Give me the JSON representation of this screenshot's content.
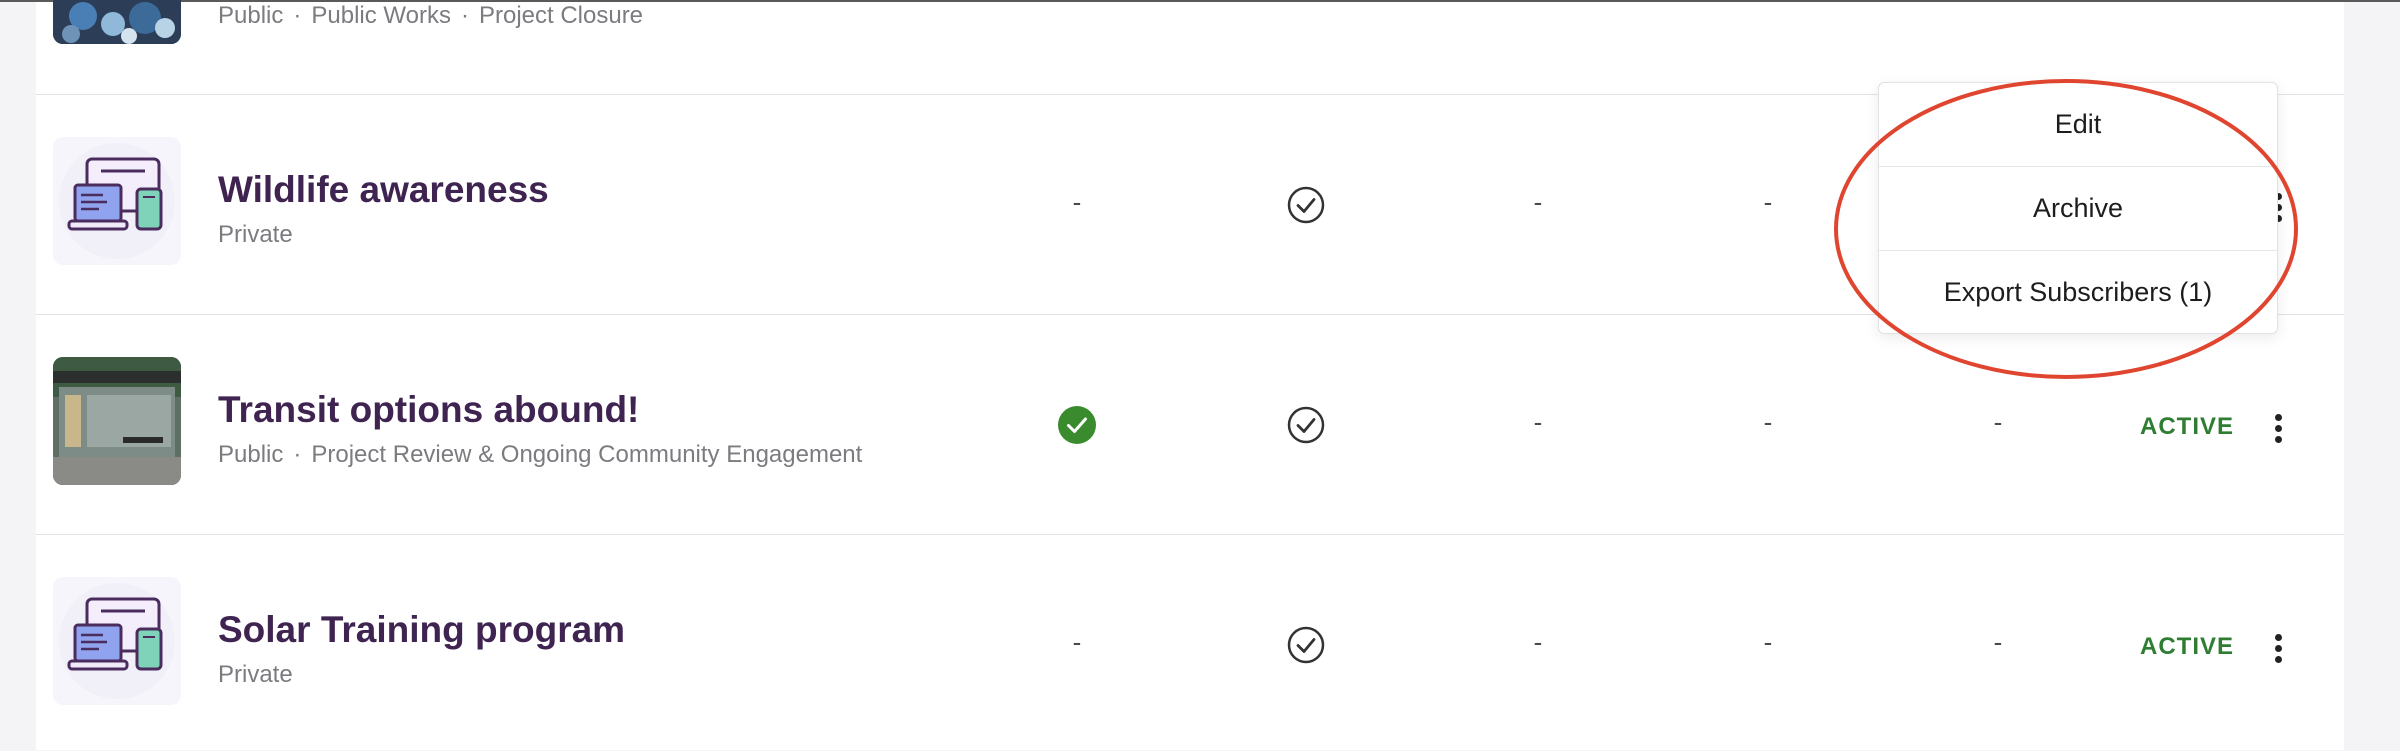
{
  "projects": [
    {
      "title": "",
      "visibility": "Public",
      "tags": [
        "Public Works",
        "Project Closure"
      ],
      "thumbnail_icon": "recycling-photo"
    },
    {
      "title": "Wildlife awareness",
      "visibility": "Private",
      "tags": [],
      "thumbnail_icon": "devices-illustration",
      "cells": [
        "-",
        "check-outline-icon",
        "-",
        "-"
      ],
      "status": ""
    },
    {
      "title": "Transit options abound!",
      "visibility": "Public",
      "tags": [
        "Project Review & Ongoing Community Engagement"
      ],
      "thumbnail_icon": "bus-shelter-photo",
      "cells": [
        "check-filled-icon",
        "check-outline-icon",
        "-",
        "-",
        "-"
      ],
      "status": "ACTIVE"
    },
    {
      "title": "Solar Training program",
      "visibility": "Private",
      "tags": [],
      "thumbnail_icon": "devices-illustration",
      "cells": [
        "-",
        "check-outline-icon",
        "-",
        "-",
        "-"
      ],
      "status": "ACTIVE"
    }
  ],
  "dash": "-",
  "dot_separator": "·",
  "context_menu": {
    "items": [
      "Edit",
      "Archive",
      "Export Subscribers (1)"
    ]
  },
  "colors": {
    "title": "#3f2350",
    "status_active": "#2f7d32",
    "check_filled": "#3a8a2e",
    "annotation": "#e0452f"
  }
}
